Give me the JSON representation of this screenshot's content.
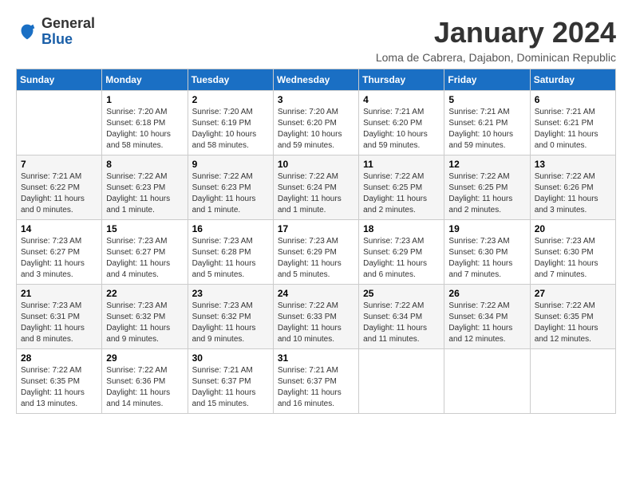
{
  "logo": {
    "general": "General",
    "blue": "Blue"
  },
  "title": "January 2024",
  "subtitle": "Loma de Cabrera, Dajabon, Dominican Republic",
  "days_of_week": [
    "Sunday",
    "Monday",
    "Tuesday",
    "Wednesday",
    "Thursday",
    "Friday",
    "Saturday"
  ],
  "weeks": [
    [
      {
        "day": "",
        "info": ""
      },
      {
        "day": "1",
        "info": "Sunrise: 7:20 AM\nSunset: 6:18 PM\nDaylight: 10 hours\nand 58 minutes."
      },
      {
        "day": "2",
        "info": "Sunrise: 7:20 AM\nSunset: 6:19 PM\nDaylight: 10 hours\nand 58 minutes."
      },
      {
        "day": "3",
        "info": "Sunrise: 7:20 AM\nSunset: 6:20 PM\nDaylight: 10 hours\nand 59 minutes."
      },
      {
        "day": "4",
        "info": "Sunrise: 7:21 AM\nSunset: 6:20 PM\nDaylight: 10 hours\nand 59 minutes."
      },
      {
        "day": "5",
        "info": "Sunrise: 7:21 AM\nSunset: 6:21 PM\nDaylight: 10 hours\nand 59 minutes."
      },
      {
        "day": "6",
        "info": "Sunrise: 7:21 AM\nSunset: 6:21 PM\nDaylight: 11 hours\nand 0 minutes."
      }
    ],
    [
      {
        "day": "7",
        "info": "Sunrise: 7:21 AM\nSunset: 6:22 PM\nDaylight: 11 hours\nand 0 minutes."
      },
      {
        "day": "8",
        "info": "Sunrise: 7:22 AM\nSunset: 6:23 PM\nDaylight: 11 hours\nand 1 minute."
      },
      {
        "day": "9",
        "info": "Sunrise: 7:22 AM\nSunset: 6:23 PM\nDaylight: 11 hours\nand 1 minute."
      },
      {
        "day": "10",
        "info": "Sunrise: 7:22 AM\nSunset: 6:24 PM\nDaylight: 11 hours\nand 1 minute."
      },
      {
        "day": "11",
        "info": "Sunrise: 7:22 AM\nSunset: 6:25 PM\nDaylight: 11 hours\nand 2 minutes."
      },
      {
        "day": "12",
        "info": "Sunrise: 7:22 AM\nSunset: 6:25 PM\nDaylight: 11 hours\nand 2 minutes."
      },
      {
        "day": "13",
        "info": "Sunrise: 7:22 AM\nSunset: 6:26 PM\nDaylight: 11 hours\nand 3 minutes."
      }
    ],
    [
      {
        "day": "14",
        "info": "Sunrise: 7:23 AM\nSunset: 6:27 PM\nDaylight: 11 hours\nand 3 minutes."
      },
      {
        "day": "15",
        "info": "Sunrise: 7:23 AM\nSunset: 6:27 PM\nDaylight: 11 hours\nand 4 minutes."
      },
      {
        "day": "16",
        "info": "Sunrise: 7:23 AM\nSunset: 6:28 PM\nDaylight: 11 hours\nand 5 minutes."
      },
      {
        "day": "17",
        "info": "Sunrise: 7:23 AM\nSunset: 6:29 PM\nDaylight: 11 hours\nand 5 minutes."
      },
      {
        "day": "18",
        "info": "Sunrise: 7:23 AM\nSunset: 6:29 PM\nDaylight: 11 hours\nand 6 minutes."
      },
      {
        "day": "19",
        "info": "Sunrise: 7:23 AM\nSunset: 6:30 PM\nDaylight: 11 hours\nand 7 minutes."
      },
      {
        "day": "20",
        "info": "Sunrise: 7:23 AM\nSunset: 6:30 PM\nDaylight: 11 hours\nand 7 minutes."
      }
    ],
    [
      {
        "day": "21",
        "info": "Sunrise: 7:23 AM\nSunset: 6:31 PM\nDaylight: 11 hours\nand 8 minutes."
      },
      {
        "day": "22",
        "info": "Sunrise: 7:23 AM\nSunset: 6:32 PM\nDaylight: 11 hours\nand 9 minutes."
      },
      {
        "day": "23",
        "info": "Sunrise: 7:23 AM\nSunset: 6:32 PM\nDaylight: 11 hours\nand 9 minutes."
      },
      {
        "day": "24",
        "info": "Sunrise: 7:22 AM\nSunset: 6:33 PM\nDaylight: 11 hours\nand 10 minutes."
      },
      {
        "day": "25",
        "info": "Sunrise: 7:22 AM\nSunset: 6:34 PM\nDaylight: 11 hours\nand 11 minutes."
      },
      {
        "day": "26",
        "info": "Sunrise: 7:22 AM\nSunset: 6:34 PM\nDaylight: 11 hours\nand 12 minutes."
      },
      {
        "day": "27",
        "info": "Sunrise: 7:22 AM\nSunset: 6:35 PM\nDaylight: 11 hours\nand 12 minutes."
      }
    ],
    [
      {
        "day": "28",
        "info": "Sunrise: 7:22 AM\nSunset: 6:35 PM\nDaylight: 11 hours\nand 13 minutes."
      },
      {
        "day": "29",
        "info": "Sunrise: 7:22 AM\nSunset: 6:36 PM\nDaylight: 11 hours\nand 14 minutes."
      },
      {
        "day": "30",
        "info": "Sunrise: 7:21 AM\nSunset: 6:37 PM\nDaylight: 11 hours\nand 15 minutes."
      },
      {
        "day": "31",
        "info": "Sunrise: 7:21 AM\nSunset: 6:37 PM\nDaylight: 11 hours\nand 16 minutes."
      },
      {
        "day": "",
        "info": ""
      },
      {
        "day": "",
        "info": ""
      },
      {
        "day": "",
        "info": ""
      }
    ]
  ]
}
